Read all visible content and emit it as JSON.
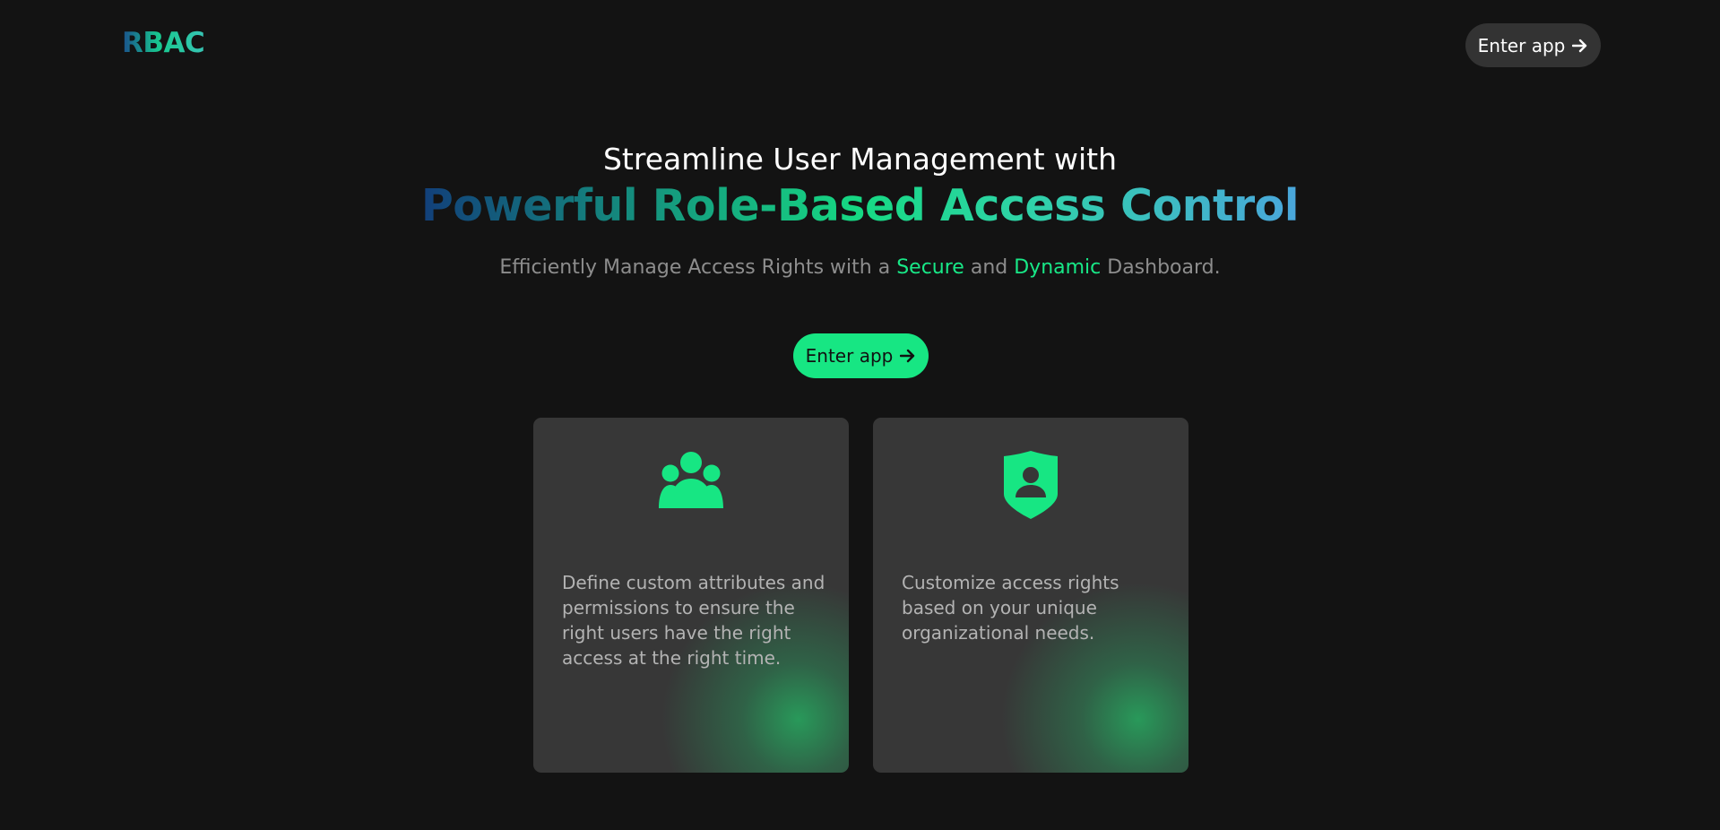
{
  "header": {
    "logo": "RBAC",
    "enter_app_label": "Enter app"
  },
  "hero": {
    "headline": "Streamline User Management with",
    "title": "Powerful Role-Based Access Control",
    "subtitle": {
      "part1": "Efficiently Manage Access Rights with a ",
      "highlight1": "Secure",
      "part2": " and ",
      "highlight2": "Dynamic",
      "part3": " Dashboard."
    },
    "cta_label": "Enter app"
  },
  "cards": [
    {
      "icon": "users-group-icon",
      "text": "Define custom attributes and permissions to ensure the right users have the right access at the right time."
    },
    {
      "icon": "shield-user-icon",
      "text": "Customize access rights based on your unique organizational needs."
    }
  ],
  "colors": {
    "background": "#131313",
    "accent": "#17e683",
    "card": "#373737",
    "nav_button": "#333333"
  }
}
